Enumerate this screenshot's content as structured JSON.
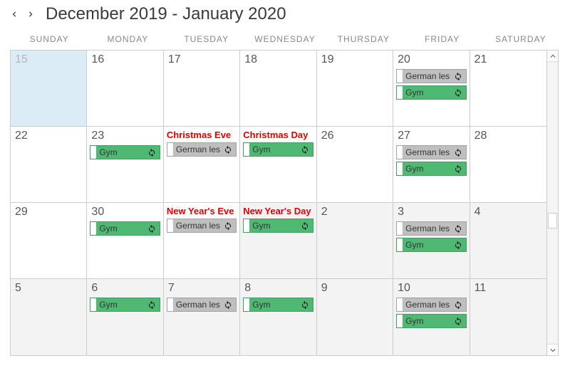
{
  "header": {
    "title": "December 2019 - January 2020"
  },
  "weekdays": [
    "SUNDAY",
    "MONDAY",
    "TUESDAY",
    "WEDNESDAY",
    "THURSDAY",
    "FRIDAY",
    "SATURDAY"
  ],
  "weeks": [
    [
      {
        "day": "15",
        "today": true
      },
      {
        "day": "16"
      },
      {
        "day": "17"
      },
      {
        "day": "18"
      },
      {
        "day": "19"
      },
      {
        "day": "20",
        "events": [
          {
            "type": "german",
            "label": "German les",
            "recur": true
          },
          {
            "type": "gym",
            "label": "Gym",
            "recur": true
          }
        ]
      },
      {
        "day": "21"
      }
    ],
    [
      {
        "day": "22"
      },
      {
        "day": "23",
        "events": [
          {
            "type": "gym",
            "label": "Gym",
            "recur": true
          }
        ]
      },
      {
        "holiday": "Christmas Eve",
        "events": [
          {
            "type": "german",
            "label": "German les",
            "recur": true
          }
        ]
      },
      {
        "holiday": "Christmas Day",
        "events": [
          {
            "type": "gym",
            "label": "Gym",
            "recur": true
          }
        ]
      },
      {
        "day": "26"
      },
      {
        "day": "27",
        "events": [
          {
            "type": "german",
            "label": "German les",
            "recur": true
          },
          {
            "type": "gym",
            "label": "Gym",
            "recur": true
          }
        ]
      },
      {
        "day": "28"
      }
    ],
    [
      {
        "day": "29"
      },
      {
        "day": "30",
        "events": [
          {
            "type": "gym",
            "label": "Gym",
            "recur": true
          }
        ]
      },
      {
        "holiday": "New Year's Eve",
        "events": [
          {
            "type": "german",
            "label": "German les",
            "recur": true
          }
        ]
      },
      {
        "holiday": "New Year's Day",
        "events": [
          {
            "type": "gym",
            "label": "Gym",
            "recur": true
          }
        ],
        "shade": true
      },
      {
        "day": "2",
        "shade": true
      },
      {
        "day": "3",
        "shade": true,
        "events": [
          {
            "type": "german",
            "label": "German les",
            "recur": true
          },
          {
            "type": "gym",
            "label": "Gym",
            "recur": true
          }
        ]
      },
      {
        "day": "4",
        "shade": true
      }
    ],
    [
      {
        "day": "5",
        "shade": true
      },
      {
        "day": "6",
        "shade": true,
        "events": [
          {
            "type": "gym",
            "label": "Gym",
            "recur": true
          }
        ]
      },
      {
        "day": "7",
        "shade": true,
        "events": [
          {
            "type": "german",
            "label": "German les",
            "recur": true
          }
        ]
      },
      {
        "day": "8",
        "shade": true,
        "events": [
          {
            "type": "gym",
            "label": "Gym",
            "recur": true
          }
        ]
      },
      {
        "day": "9",
        "shade": true
      },
      {
        "day": "10",
        "shade": true,
        "events": [
          {
            "type": "german",
            "label": "German les",
            "recur": true
          },
          {
            "type": "gym",
            "label": "Gym",
            "recur": true
          }
        ]
      },
      {
        "day": "11",
        "shade": true
      }
    ]
  ]
}
